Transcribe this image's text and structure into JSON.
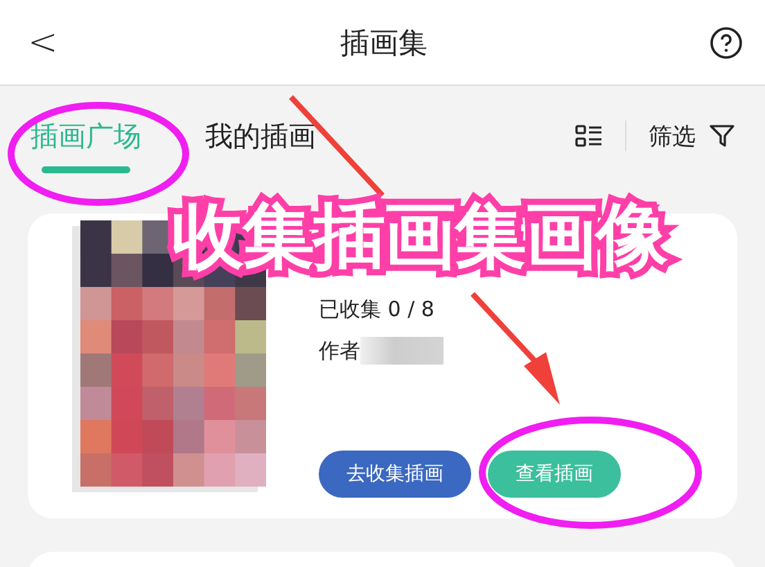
{
  "header": {
    "title": "插画集",
    "back": "<"
  },
  "tabs": [
    {
      "label": "插画广场",
      "selected": true
    },
    {
      "label": "我的插画",
      "selected": false
    }
  ],
  "filter": {
    "label": "筛选"
  },
  "card": {
    "collected": "已收集 0 / 8",
    "author_label": "作者",
    "buttons": [
      {
        "label": "去收集插画",
        "color": "#3b68c0"
      },
      {
        "label": "查看插画",
        "color": "#3bbf9c"
      }
    ]
  },
  "annotation": {
    "caption": "收集插画集画像"
  }
}
